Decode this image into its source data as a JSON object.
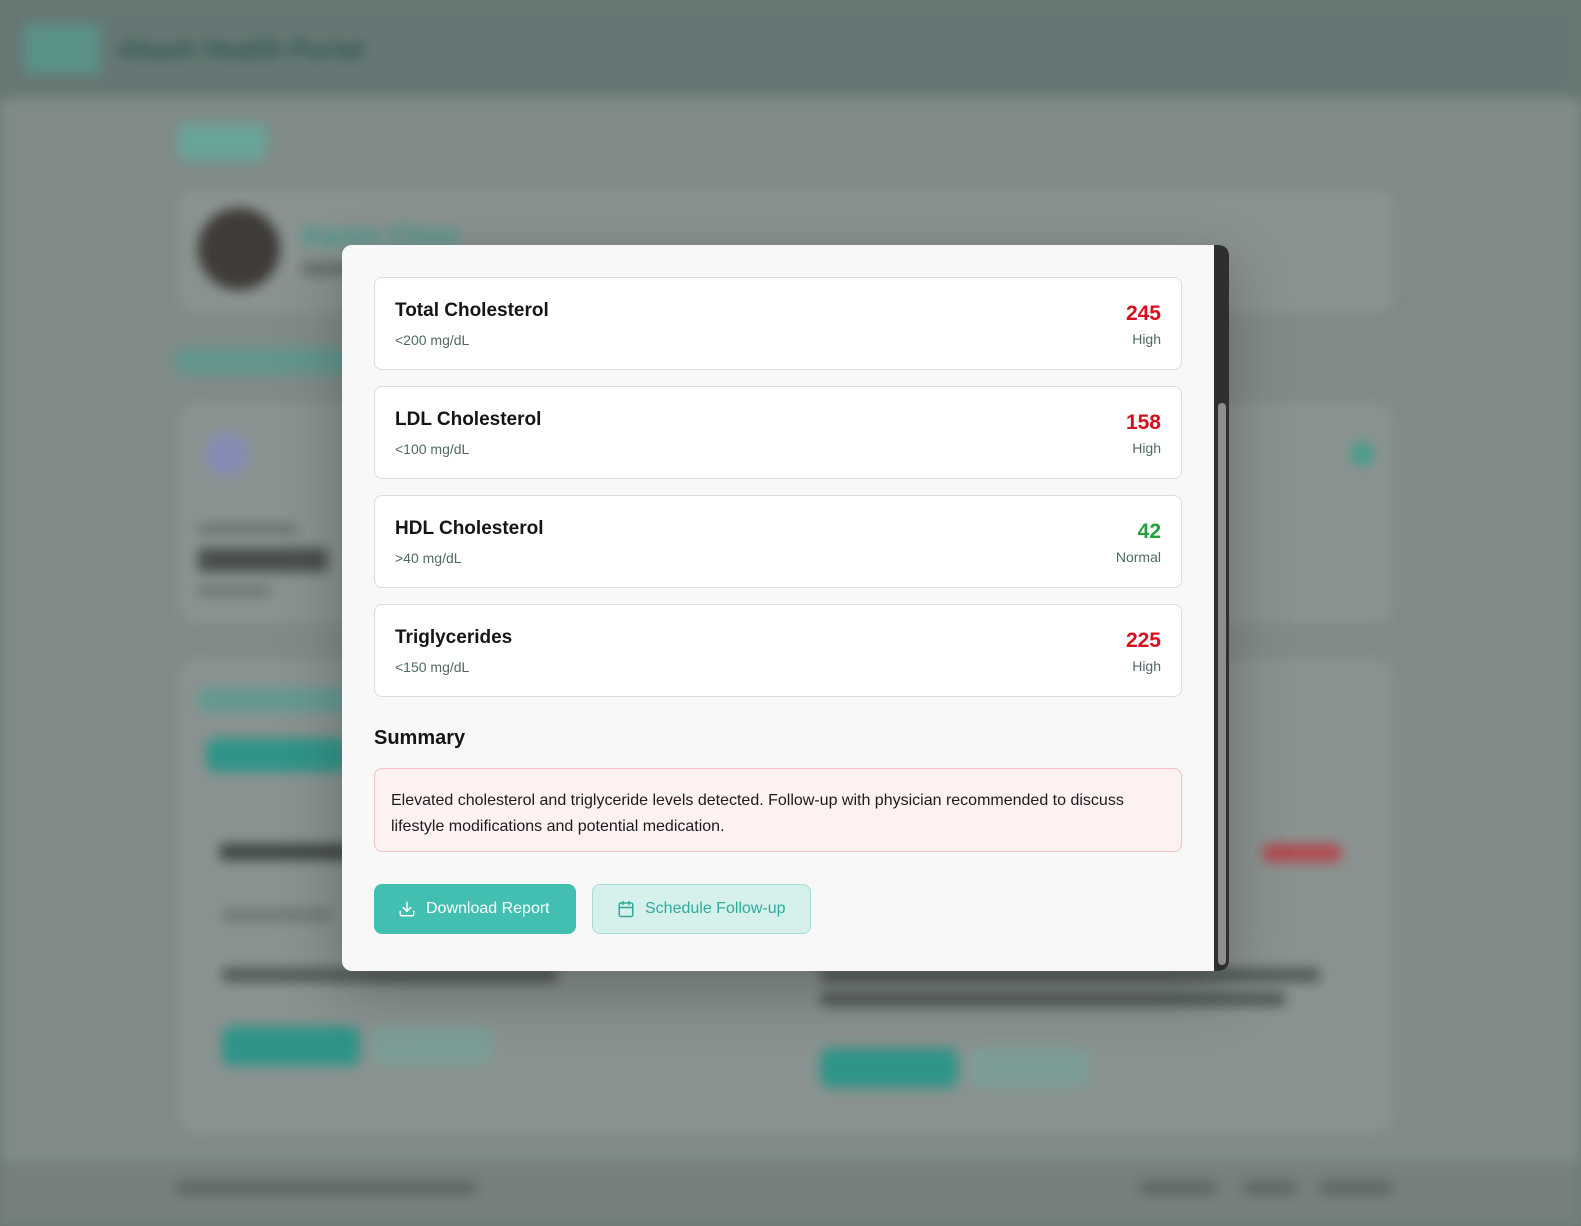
{
  "background": {
    "brand": "Akash Health Portal",
    "patient_name": "Karen Chen"
  },
  "results": [
    {
      "name": "Total Cholesterol",
      "range": "<200 mg/dL",
      "value": "245",
      "status": "High",
      "color": "#d6111f"
    },
    {
      "name": "LDL Cholesterol",
      "range": "<100 mg/dL",
      "value": "158",
      "status": "High",
      "color": "#d6111f"
    },
    {
      "name": "HDL Cholesterol",
      "range": ">40 mg/dL",
      "value": "42",
      "status": "Normal",
      "color": "#23a23b"
    },
    {
      "name": "Triglycerides",
      "range": "<150 mg/dL",
      "value": "225",
      "status": "High",
      "color": "#d6111f"
    }
  ],
  "summary": {
    "title": "Summary",
    "text": "Elevated cholesterol and triglyceride levels detected. Follow-up with physician recommended to discuss lifestyle modifications and potential medication."
  },
  "actions": {
    "download_label": "Download Report",
    "download_icon": "download-icon",
    "schedule_label": "Schedule Follow-up",
    "schedule_icon": "calendar-icon"
  },
  "colors": {
    "accent": "#42bfb0",
    "high": "#d6111f",
    "normal": "#23a23b"
  }
}
